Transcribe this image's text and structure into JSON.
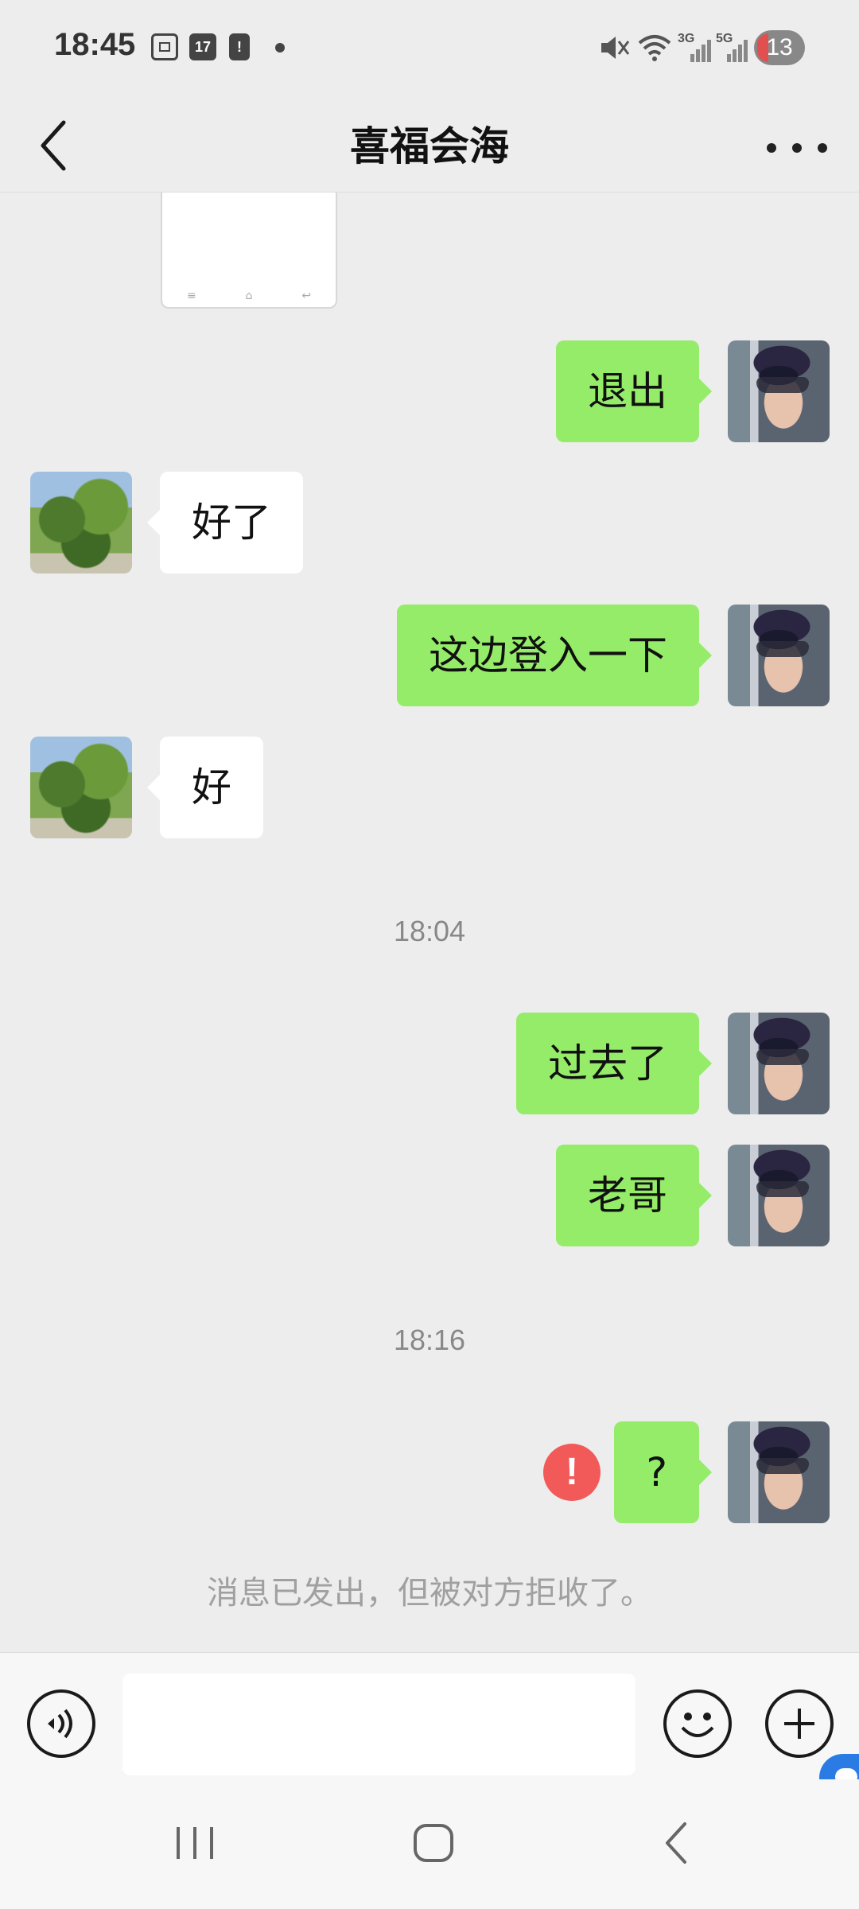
{
  "status_bar": {
    "time": "18:45",
    "calendar_day": "17",
    "net_3g": "3G",
    "net_5g": "5G",
    "notification_count": "13",
    "icons": [
      "screenshot-icon",
      "calendar-icon",
      "battery-alert-icon",
      "dot-icon",
      "mute-icon",
      "wifi-icon",
      "signal-3g-icon",
      "signal-5g-icon"
    ]
  },
  "header": {
    "title": "喜福会海",
    "back_icon": "chevron-left-icon",
    "more_icon": "more-dots-icon"
  },
  "messages": [
    {
      "side": "other",
      "type": "image"
    },
    {
      "side": "me",
      "text": "退出"
    },
    {
      "side": "other",
      "text": "好了"
    },
    {
      "side": "me",
      "text": "这边登入一下"
    },
    {
      "side": "other",
      "text": "好"
    },
    {
      "type": "timestamp",
      "text": "18:04"
    },
    {
      "side": "me",
      "text": "过去了"
    },
    {
      "side": "me",
      "text": "老哥"
    },
    {
      "type": "timestamp",
      "text": "18:16"
    },
    {
      "side": "me",
      "text": "?",
      "status": "rejected",
      "status_icon": "!"
    },
    {
      "type": "system",
      "text": "消息已发出，但被对方拒收了。"
    }
  ],
  "input_bar": {
    "placeholder": "",
    "voice_icon": "voice-icon",
    "emoji_icon": "emoji-icon",
    "plus_icon": "plus-icon"
  },
  "nav_bar": {
    "icons": [
      "recent-apps-icon",
      "home-icon",
      "back-icon"
    ]
  },
  "colors": {
    "background": "#ededed",
    "my_bubble": "#95ec69",
    "other_bubble": "#ffffff",
    "error": "#f25a5a"
  }
}
